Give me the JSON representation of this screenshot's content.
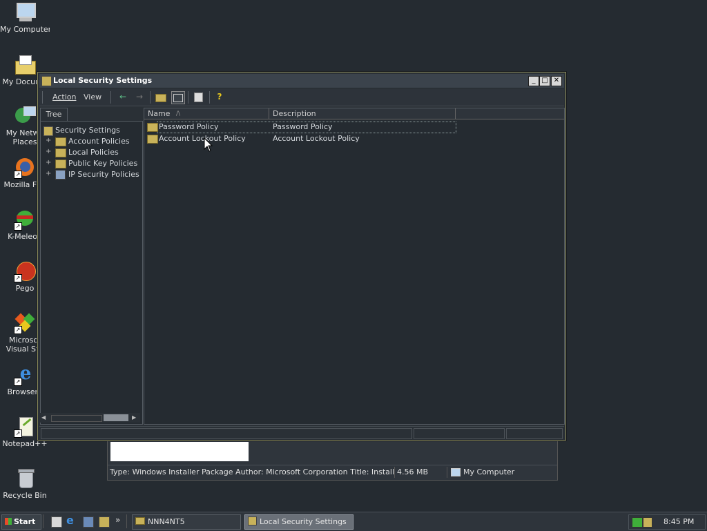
{
  "desktop": {
    "icons": [
      {
        "label": "My Computer",
        "icon": "computer-icon"
      },
      {
        "label": "My Docume",
        "icon": "documents-folder-icon"
      },
      {
        "label": "My Netwo",
        "label2": "Places",
        "icon": "network-places-icon"
      },
      {
        "label": "Mozilla Fire",
        "icon": "firefox-icon"
      },
      {
        "label": "K-Meleon",
        "icon": "kmeleon-icon"
      },
      {
        "label": "Pego",
        "icon": "pego-icon"
      },
      {
        "label": "Microsof",
        "label2": "Visual Stu",
        "icon": "visual-studio-icon"
      },
      {
        "label": "Browserv",
        "icon": "internet-explorer-icon"
      },
      {
        "label": "Notepad++",
        "icon": "notepadpp-icon"
      },
      {
        "label": "Recycle Bin",
        "icon": "recycle-bin-icon"
      }
    ]
  },
  "bg_window": {
    "status": "Type: Windows Installer Package Author: Microsoft Corporation Title: Installation Dat",
    "size": "4.56 MB",
    "zone": "My Computer"
  },
  "window": {
    "title": "Local Security Settings",
    "menu": {
      "action": "Action",
      "view": "View"
    },
    "controls": {
      "minimize": "_",
      "maximize": "□",
      "close": "✕"
    }
  },
  "tree": {
    "tab": "Tree",
    "root": "Security Settings",
    "items": [
      {
        "label": "Account Policies"
      },
      {
        "label": "Local Policies"
      },
      {
        "label": "Public Key Policies"
      },
      {
        "label": "IP Security Policies on"
      }
    ]
  },
  "list": {
    "columns": {
      "name": "Name",
      "sort_indicator": "/\\",
      "description": "Description"
    },
    "rows": [
      {
        "name": "Password Policy",
        "description": "Password Policy"
      },
      {
        "name": "Account Lockout Policy",
        "description": "Account Lockout Policy"
      }
    ]
  },
  "taskbar": {
    "start": "Start",
    "tasks": [
      {
        "label": "NNN4NT5"
      },
      {
        "label": "Local Security Settings"
      }
    ],
    "chevron": "»",
    "clock": "8:45 PM"
  },
  "colors": {
    "desktop": "#252b31",
    "folder": "#c8b25a",
    "active_task": "#6a7078"
  }
}
